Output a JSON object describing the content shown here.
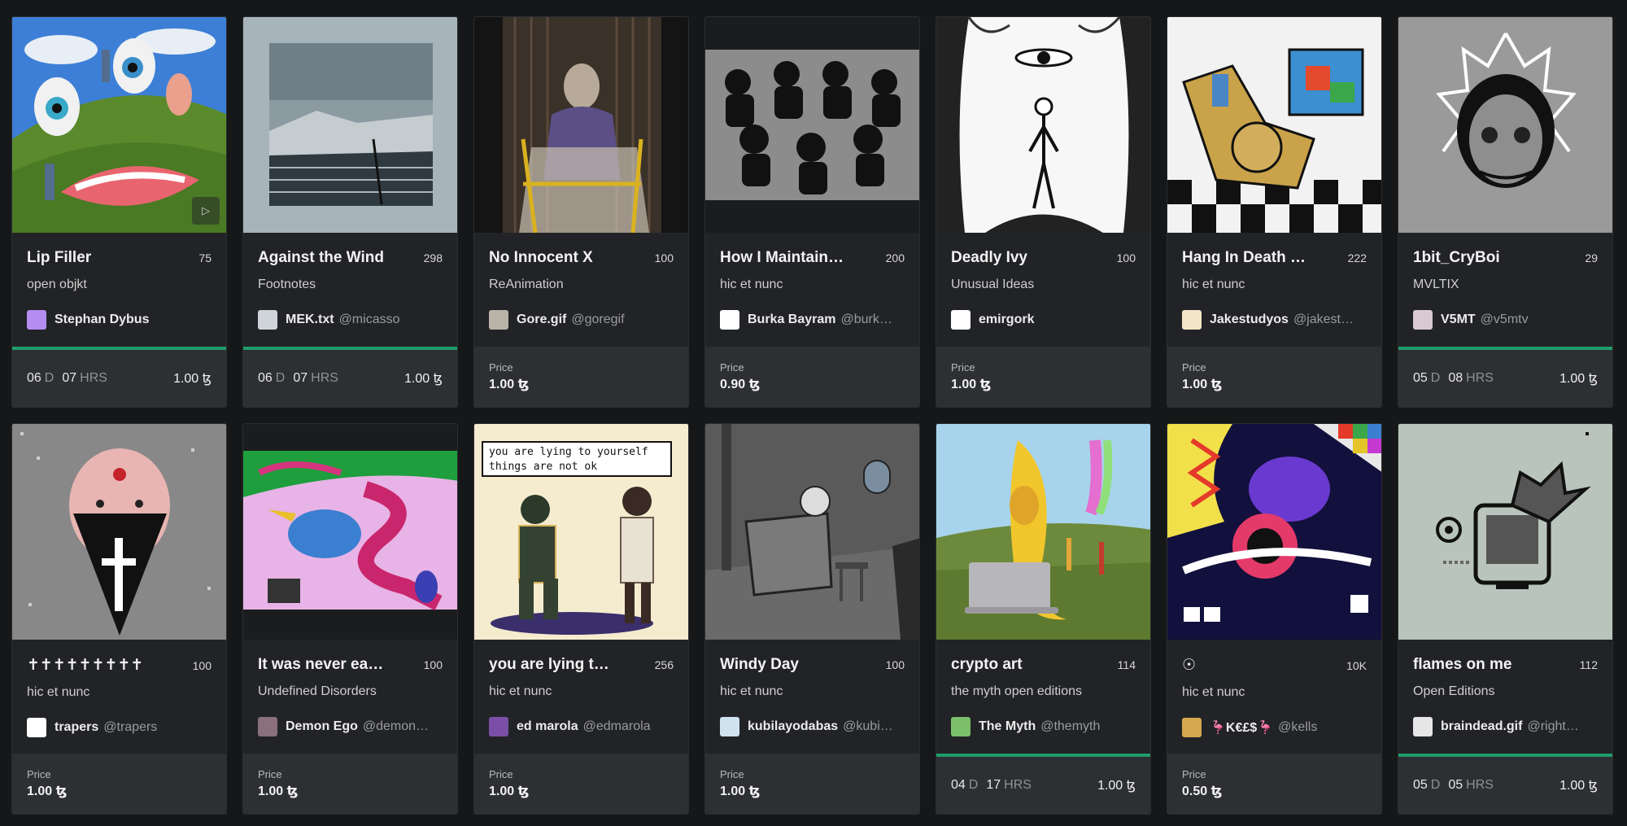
{
  "cards": [
    {
      "title": "Lip Filler",
      "count": "75",
      "collection": "open objkt",
      "artist": "Stephan Dybus",
      "handle": "",
      "type": "auction",
      "days": "06",
      "d_unit": "D",
      "hours": "07",
      "h_unit": "HRS",
      "price": "1.00 ꜩ",
      "avatar_color": "#b58cf0",
      "play": "▷"
    },
    {
      "title": "Against the Wind",
      "count": "298",
      "collection": "Footnotes",
      "artist": "MEK.txt",
      "handle": "@micasso",
      "type": "auction",
      "days": "06",
      "d_unit": "D",
      "hours": "07",
      "h_unit": "HRS",
      "price": "1.00 ꜩ",
      "avatar_color": "#cfd4d8"
    },
    {
      "title": "No Innocent X",
      "count": "100",
      "collection": "ReAnimation",
      "artist": "Gore.gif",
      "handle": "@goregif",
      "type": "fixed",
      "price_label": "Price",
      "price": "1.00 ꜩ",
      "avatar_color": "#b9b3a8"
    },
    {
      "title": "How I Maintain…",
      "count": "200",
      "collection": "hic et nunc",
      "artist": "Burka Bayram",
      "handle": "@burk…",
      "type": "fixed",
      "price_label": "Price",
      "price": "0.90 ꜩ",
      "avatar_color": "#ffffff"
    },
    {
      "title": "Deadly Ivy",
      "count": "100",
      "collection": "Unusual Ideas",
      "artist": "emirgork",
      "handle": "",
      "type": "fixed",
      "price_label": "Price",
      "price": "1.00 ꜩ",
      "avatar_color": "#ffffff"
    },
    {
      "title": "Hang In Death …",
      "count": "222",
      "collection": "hic et nunc",
      "artist": "Jakestudyos",
      "handle": "@jakest…",
      "type": "fixed",
      "price_label": "Price",
      "price": "1.00 ꜩ",
      "avatar_color": "#f2e6c9"
    },
    {
      "title": "1bit_CryBoi",
      "count": "29",
      "collection": "MVLTIX",
      "artist": "V5MT",
      "handle": "@v5mtv",
      "type": "auction",
      "days": "05",
      "d_unit": "D",
      "hours": "08",
      "h_unit": "HRS",
      "price": "1.00 ꜩ",
      "avatar_color": "#d9c9d3"
    },
    {
      "title": "✝︎✝︎✝︎✝︎✝︎✝︎✝︎✝︎✝︎",
      "count": "100",
      "collection": "hic et nunc",
      "artist": "trapers",
      "handle": "@trapers",
      "type": "fixed",
      "price_label": "Price",
      "price": "1.00 ꜩ",
      "avatar_color": "#ffffff"
    },
    {
      "title": "It was never ea…",
      "count": "100",
      "collection": "Undefined Disorders",
      "artist": "Demon Ego",
      "handle": "@demon…",
      "type": "fixed",
      "price_label": "Price",
      "price": "1.00 ꜩ",
      "avatar_color": "#8a6f7c"
    },
    {
      "title": "you are lying t…",
      "count": "256",
      "collection": "hic et nunc",
      "artist": "ed marola",
      "handle": "@edmarola",
      "type": "fixed",
      "price_label": "Price",
      "price": "1.00 ꜩ",
      "avatar_color": "#7b4fa8"
    },
    {
      "title": "Windy Day",
      "count": "100",
      "collection": "hic et nunc",
      "artist": "kubilayodabas",
      "handle": "@kubi…",
      "type": "fixed",
      "price_label": "Price",
      "price": "1.00 ꜩ",
      "avatar_color": "#cfe3ef"
    },
    {
      "title": "crypto art",
      "count": "114",
      "collection": "the myth open editions",
      "artist": "The Myth",
      "handle": "@themyth",
      "type": "auction",
      "days": "04",
      "d_unit": "D",
      "hours": "17",
      "h_unit": "HRS",
      "price": "1.00 ꜩ",
      "avatar_color": "#7bbf6a"
    },
    {
      "title": "☉",
      "count": "10K",
      "collection": "hic et nunc",
      "artist": "🦩K€£$🦩",
      "handle": "@kells",
      "type": "fixed",
      "price_label": "Price",
      "price": "0.50 ꜩ",
      "avatar_color": "#d6a84f"
    },
    {
      "title": "flames on me",
      "count": "112",
      "collection": "Open Editions",
      "artist": "braindead.gif",
      "handle": "@right…",
      "type": "auction",
      "days": "05",
      "d_unit": "D",
      "hours": "05",
      "h_unit": "HRS",
      "price": "1.00 ꜩ",
      "avatar_color": "#e6e6e6"
    }
  ]
}
